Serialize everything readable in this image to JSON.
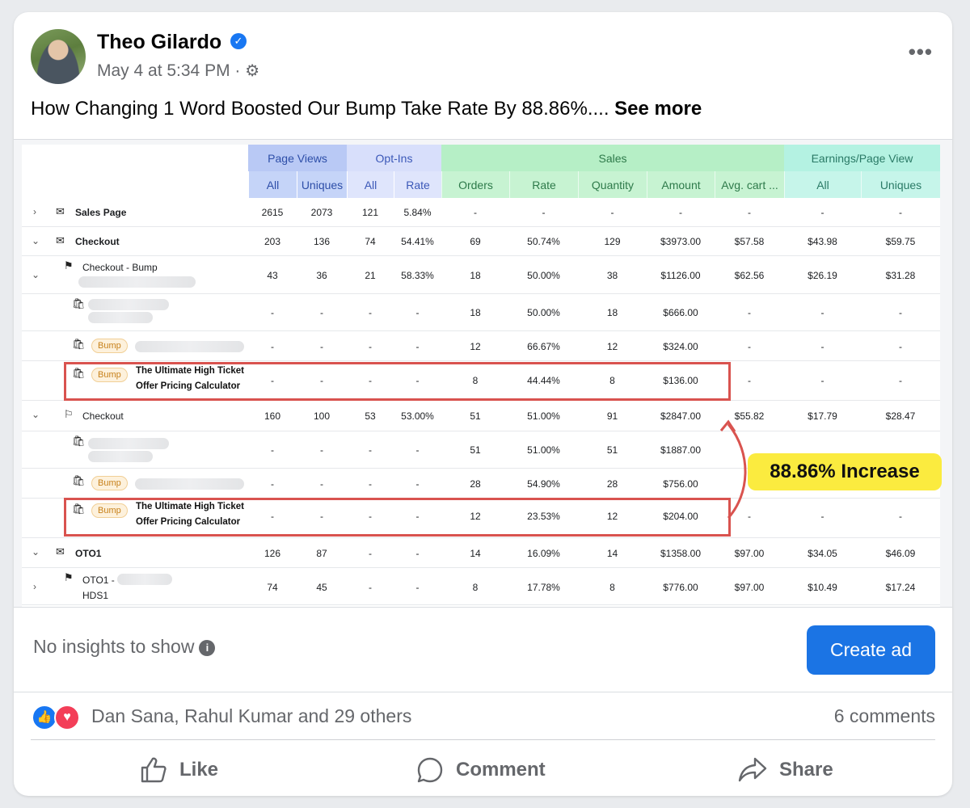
{
  "post": {
    "author": "Theo Gilardo",
    "timestamp": "May 4 at 5:34 PM",
    "meta_separator": "·",
    "text": "How Changing 1 Word Boosted Our Bump Take Rate By 88.86%....",
    "see_more": "See more"
  },
  "icons": {
    "verified": "verified-badge-icon",
    "gear": "gear-icon",
    "more": "more-options-icon",
    "info": "info-icon"
  },
  "table": {
    "groups": [
      "Page Views",
      "Opt-Ins",
      "Sales",
      "Earnings/Page View"
    ],
    "subheaders": [
      "All",
      "Uniques",
      "All",
      "Rate",
      "Orders",
      "Rate",
      "Quantity",
      "Amount",
      "Avg. cart ...",
      "All",
      "Uniques"
    ],
    "rows": [
      {
        "label": "Sales Page",
        "values": [
          "2615",
          "2073",
          "121",
          "5.84%",
          "-",
          "-",
          "-",
          "-",
          "-",
          "-",
          "-"
        ]
      },
      {
        "label": "Checkout",
        "values": [
          "203",
          "136",
          "74",
          "54.41%",
          "69",
          "50.74%",
          "129",
          "$3973.00",
          "$57.58",
          "$43.98",
          "$59.75"
        ]
      },
      {
        "label": "Checkout - Bump",
        "values": [
          "43",
          "36",
          "21",
          "58.33%",
          "18",
          "50.00%",
          "38",
          "$1126.00",
          "$62.56",
          "$26.19",
          "$31.28"
        ]
      },
      {
        "label": "",
        "values": [
          "-",
          "-",
          "-",
          "-",
          "18",
          "50.00%",
          "18",
          "$666.00",
          "-",
          "-",
          "-"
        ]
      },
      {
        "label": "",
        "badge": "Bump",
        "values": [
          "-",
          "-",
          "-",
          "-",
          "12",
          "66.67%",
          "12",
          "$324.00",
          "-",
          "-",
          "-"
        ]
      },
      {
        "label": "The Ultimate High Ticket",
        "label2": "Offer Pricing Calculator",
        "badge": "Bump",
        "values": [
          "-",
          "-",
          "-",
          "-",
          "8",
          "44.44%",
          "8",
          "$136.00",
          "-",
          "-",
          "-"
        ]
      },
      {
        "label": "Checkout",
        "values": [
          "160",
          "100",
          "53",
          "53.00%",
          "51",
          "51.00%",
          "91",
          "$2847.00",
          "$55.82",
          "$17.79",
          "$28.47"
        ]
      },
      {
        "label": "",
        "values": [
          "-",
          "-",
          "-",
          "-",
          "51",
          "51.00%",
          "51",
          "$1887.00",
          "-",
          "-",
          "-"
        ]
      },
      {
        "label": "",
        "badge": "Bump",
        "values": [
          "-",
          "-",
          "-",
          "-",
          "28",
          "54.90%",
          "28",
          "$756.00",
          "-",
          "-",
          "-"
        ]
      },
      {
        "label": "The Ultimate High Ticket",
        "label2": "Offer Pricing Calculator",
        "badge": "Bump",
        "values": [
          "-",
          "-",
          "-",
          "-",
          "12",
          "23.53%",
          "12",
          "$204.00",
          "-",
          "-",
          "-"
        ]
      },
      {
        "label": "OTO1",
        "values": [
          "126",
          "87",
          "-",
          "-",
          "14",
          "16.09%",
          "14",
          "$1358.00",
          "$97.00",
          "$34.05",
          "$46.09"
        ]
      },
      {
        "label": "OTO1 -",
        "label2": "HDS1",
        "values": [
          "74",
          "45",
          "-",
          "-",
          "8",
          "17.78%",
          "8",
          "$776.00",
          "$97.00",
          "$10.49",
          "$17.24"
        ]
      }
    ],
    "callout": "88.86% Increase"
  },
  "insights": {
    "text": "No insights to show",
    "create_ad": "Create ad"
  },
  "engagement": {
    "reactors": "Dan Sana, Rahul Kumar and 29 others",
    "comments": "6 comments"
  },
  "actions": {
    "like": "Like",
    "comment": "Comment",
    "share": "Share"
  },
  "colors": {
    "primary": "#1b74e4",
    "highlight": "#d9534f",
    "callout": "#fbeb3f"
  }
}
